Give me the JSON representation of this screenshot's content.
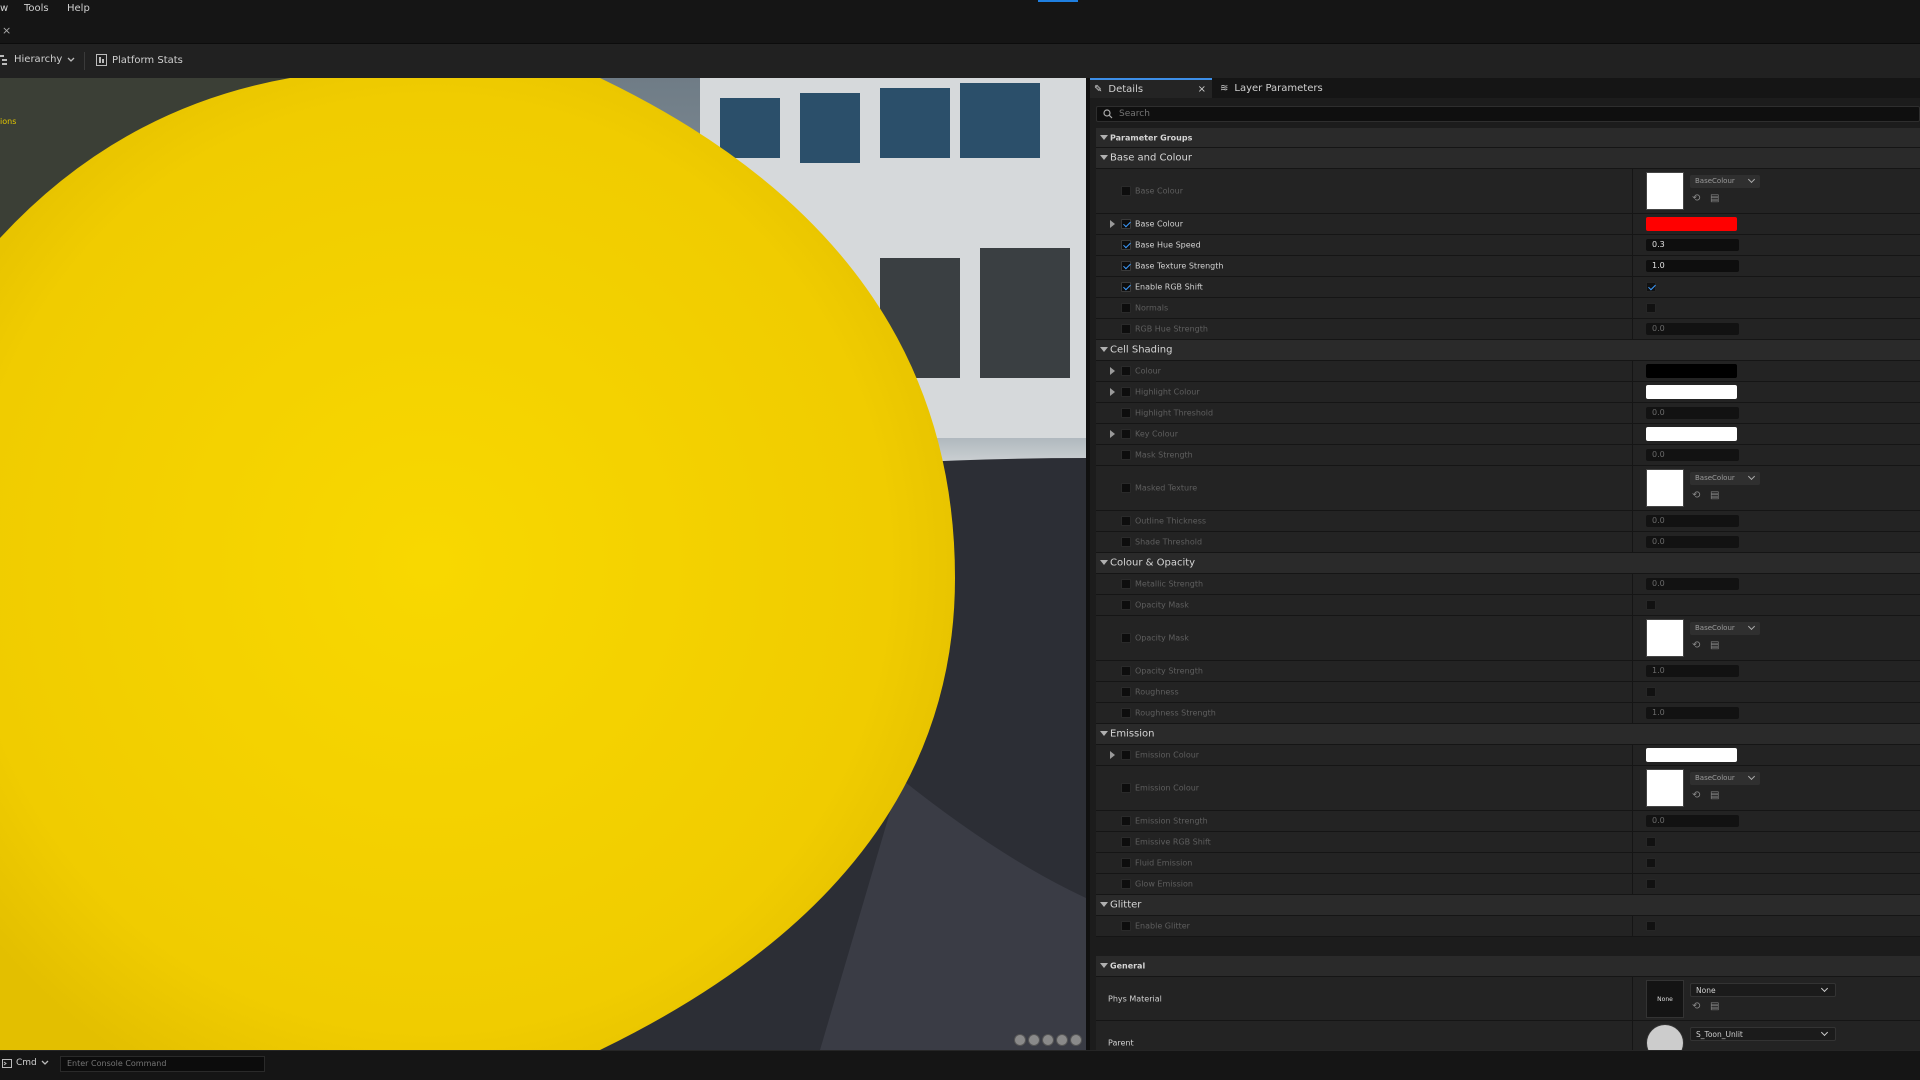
{
  "menu": {
    "items": [
      "w",
      "Tools",
      "Help"
    ]
  },
  "tabrow": {
    "close": "×"
  },
  "toolbar": {
    "hierarchy": "Hierarchy",
    "platform_stats": "Platform Stats"
  },
  "viewport": {
    "overlay_text": "ions",
    "preview_color": "#f5d200"
  },
  "panel": {
    "tabs": {
      "details": "Details",
      "details_close": "×",
      "layer_parameters": "Layer Parameters"
    },
    "search_placeholder": "Search",
    "parameter_groups": "Parameter Groups",
    "sections": {
      "base": "Base and Colour",
      "cell": "Cell Shading",
      "opacity": "Colour & Opacity",
      "emission": "Emission",
      "glitter": "Glitter",
      "general": "General"
    },
    "texture_dropdown": "BaseColour",
    "rows": {
      "base_colour_tex": "Base Colour",
      "base_colour": "Base Colour",
      "base_hue_speed": "Base Hue Speed",
      "base_hue_speed_value": "0.3",
      "base_texture_strength": "Base Texture Strength",
      "base_texture_strength_value": "1.0",
      "enable_rgb_shift": "Enable RGB Shift",
      "normals": "Normals",
      "rgb_hue_strength": "RGB Hue Strength",
      "rgb_hue_strength_value": "0.0",
      "colour": "Colour",
      "highlight_colour": "Highlight Colour",
      "highlight_threshold": "Highlight Threshold",
      "highlight_threshold_value": "0.0",
      "key_colour": "Key Colour",
      "mask_strength": "Mask Strength",
      "mask_strength_value": "0.0",
      "masked_texture": "Masked Texture",
      "outline_thickness": "Outline Thickness",
      "outline_thickness_value": "0.0",
      "shade_threshold": "Shade Threshold",
      "shade_threshold_value": "0.0",
      "metallic_strength": "Metallic Strength",
      "metallic_strength_value": "0.0",
      "opacity_mask_bool": "Opacity Mask",
      "opacity_mask_tex": "Opacity Mask",
      "opacity_strength": "Opacity Strength",
      "opacity_strength_value": "1.0",
      "roughness": "Roughness",
      "roughness_strength": "Roughness Strength",
      "roughness_strength_value": "1.0",
      "emission_colour": "Emission Colour",
      "emission_colour_tex": "Emission Colour",
      "emission_strength": "Emission Strength",
      "emission_strength_value": "0.0",
      "emissive_rgb_shift": "Emissive RGB Shift",
      "fluid_emission": "Fluid Emission",
      "glow_emission": "Glow Emission",
      "enable_glitter": "Enable Glitter",
      "phys_material": "Phys Material",
      "phys_material_thumb": "None",
      "phys_material_value": "None",
      "parent": "Parent",
      "parent_value": "S_Toon_Unlit"
    },
    "colors": {
      "base_colour": "#ff0000",
      "cell_colour": "#000000",
      "highlight_colour": "#ffffff",
      "key_colour": "#ffffff",
      "emission_colour": "#ffffff"
    }
  },
  "statusbar": {
    "cmd": "Cmd",
    "console_placeholder": "Enter Console Command"
  }
}
